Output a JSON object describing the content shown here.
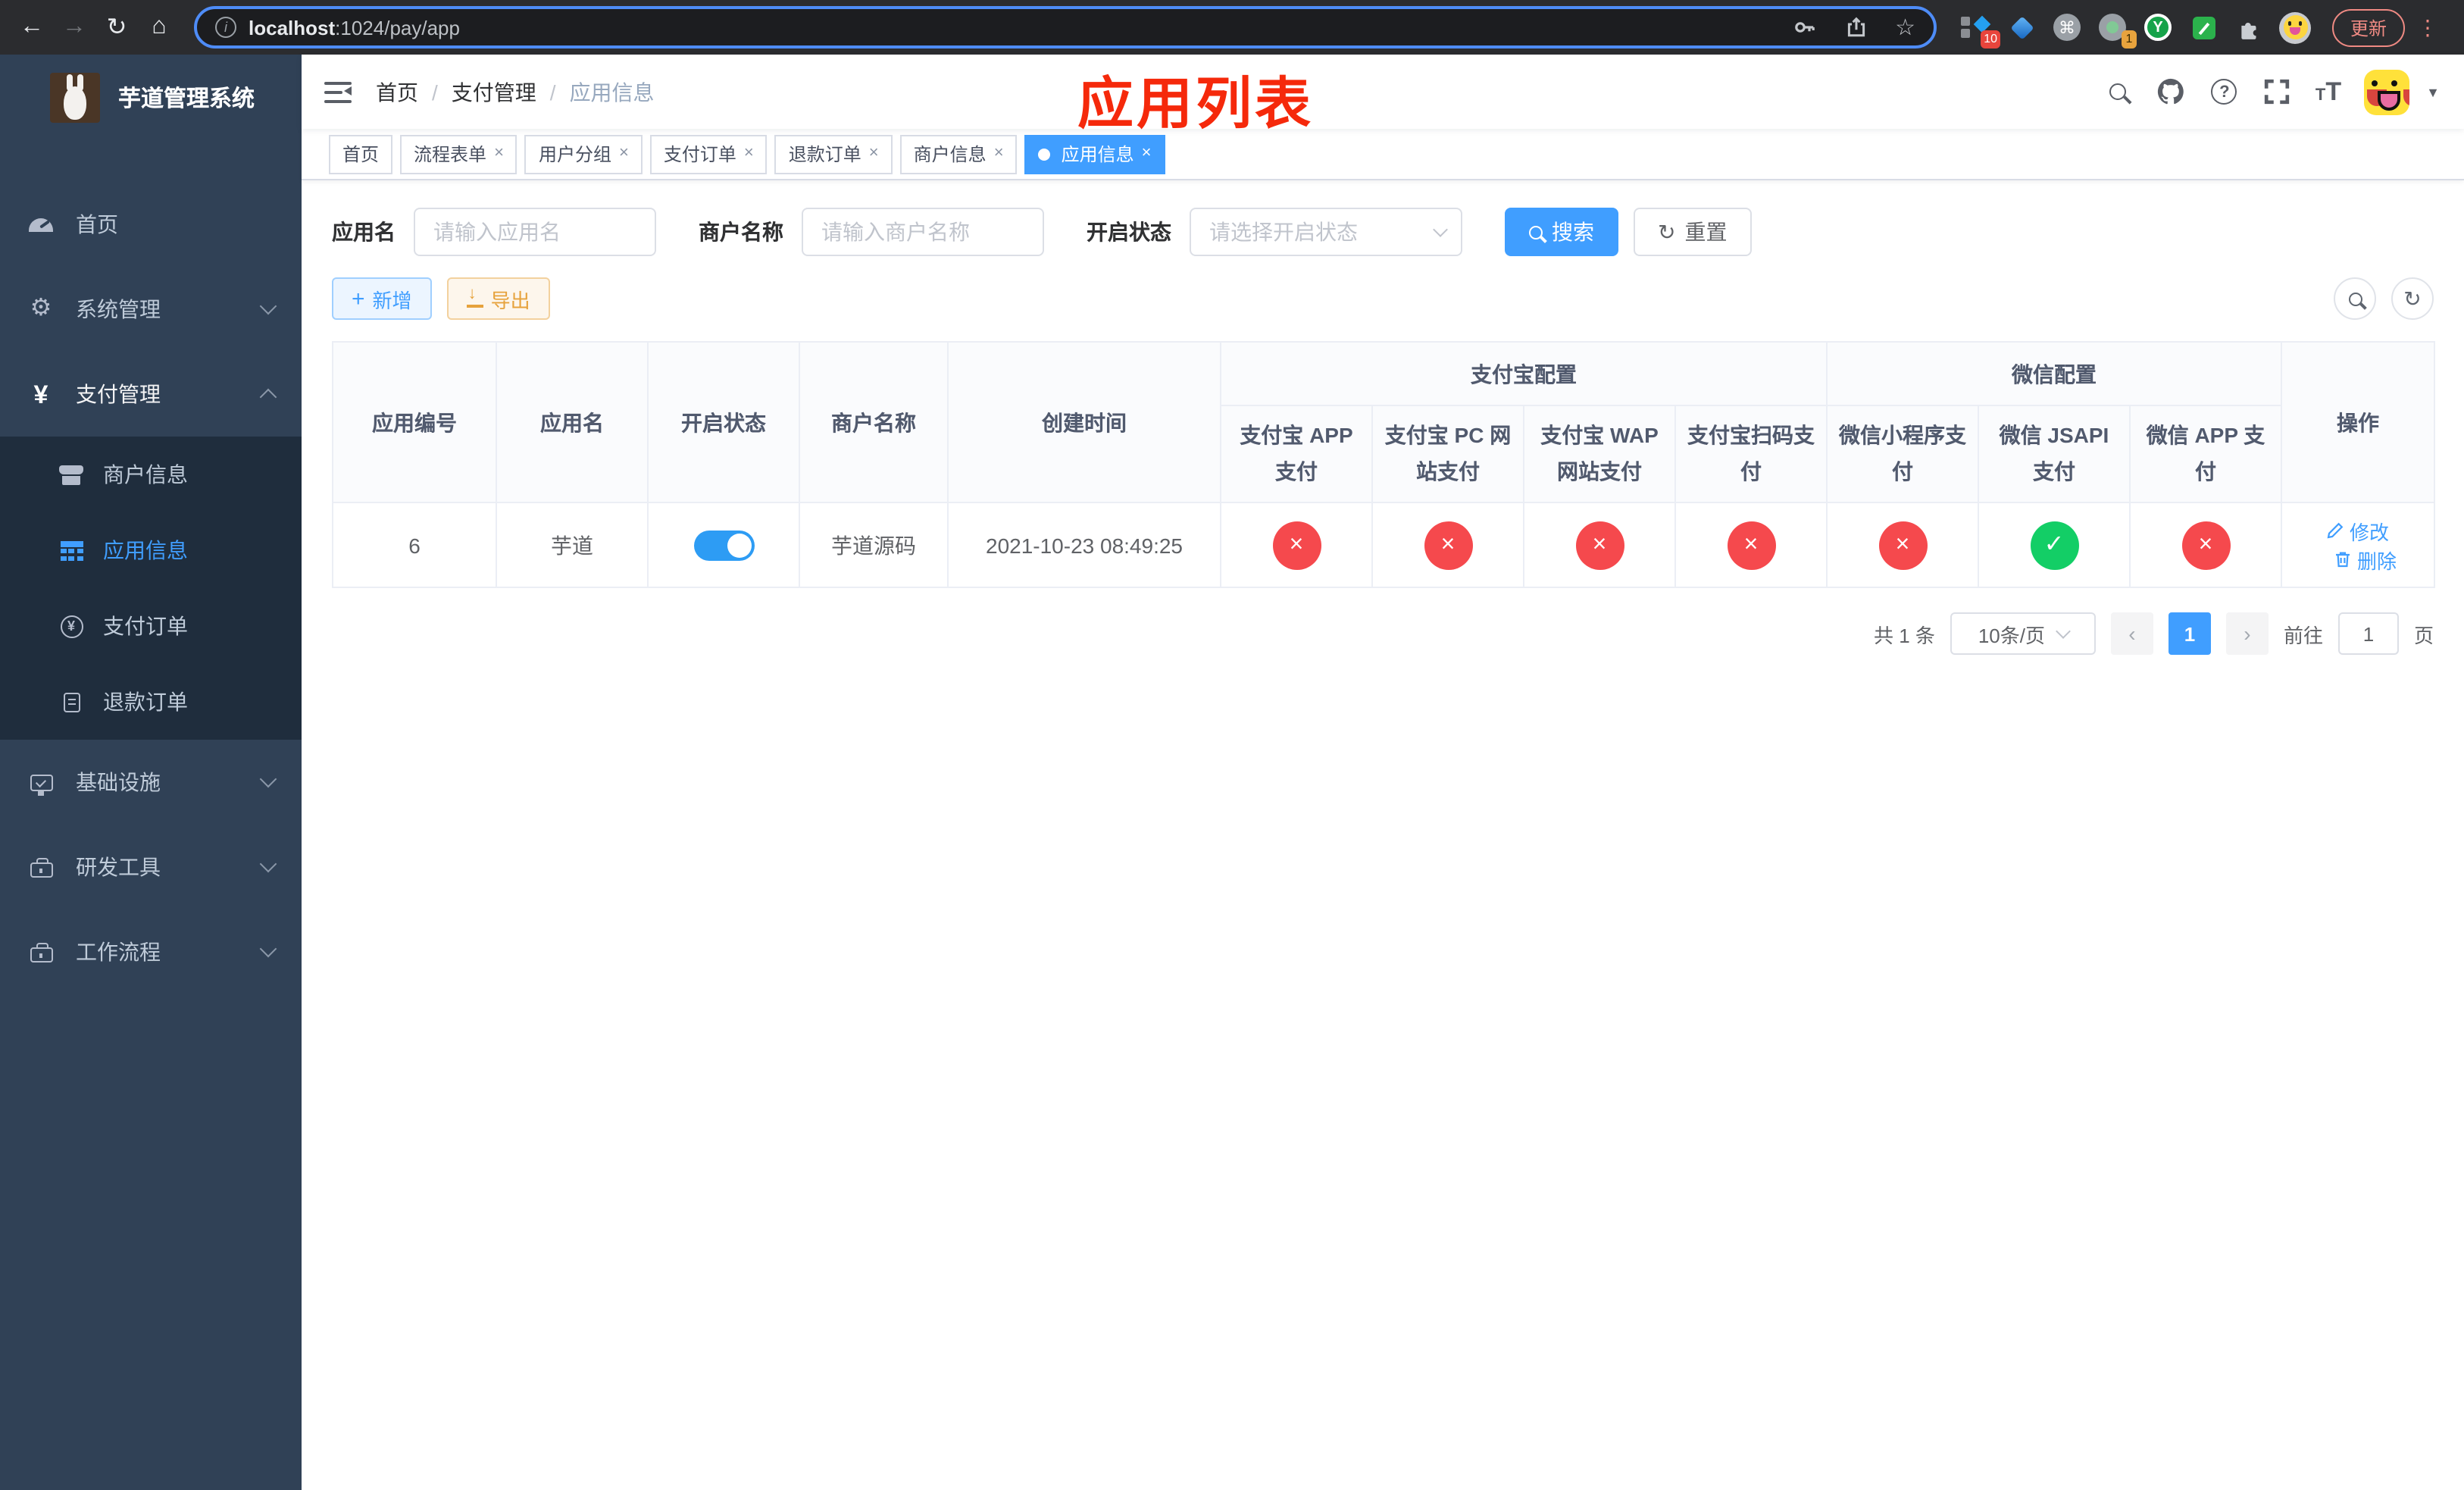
{
  "browser": {
    "url": {
      "host": "localhost",
      "path": ":1024/pay/app"
    },
    "update_label": "更新",
    "ext_badge_count": "10",
    "ext_badge_one": "1",
    "y_logo": "Y"
  },
  "icons": {
    "back": "←",
    "forward": "→",
    "reload": "↻",
    "home": "⌂",
    "info": "i",
    "star": "☆",
    "command": "⌘",
    "dots": "⋮",
    "caret_down": "▼",
    "plus": "+",
    "yen": "¥",
    "question": "?",
    "small_t": "T",
    "big_t": "T",
    "refresh": "↻",
    "prev": "‹",
    "next": "›"
  },
  "sidebar": {
    "brand": "芋道管理系统",
    "menu_top": [
      {
        "label": "首页"
      },
      {
        "label": "系统管理"
      },
      {
        "label": "支付管理"
      }
    ],
    "submenu": [
      {
        "label": "商户信息"
      },
      {
        "label": "应用信息"
      },
      {
        "label": "支付订单"
      },
      {
        "label": "退款订单"
      }
    ],
    "menu_bottom": [
      {
        "label": "基础设施"
      },
      {
        "label": "研发工具"
      },
      {
        "label": "工作流程"
      }
    ]
  },
  "navbar": {
    "breadcrumb": [
      {
        "label": "首页"
      },
      {
        "label": "支付管理"
      },
      {
        "label": "应用信息"
      }
    ],
    "separator": "/"
  },
  "annotation": "应用列表",
  "tags": [
    {
      "label": "首页",
      "closable": false,
      "active": false
    },
    {
      "label": "流程表单",
      "closable": true,
      "active": false
    },
    {
      "label": "用户分组",
      "closable": true,
      "active": false
    },
    {
      "label": "支付订单",
      "closable": true,
      "active": false
    },
    {
      "label": "退款订单",
      "closable": true,
      "active": false
    },
    {
      "label": "商户信息",
      "closable": true,
      "active": false
    },
    {
      "label": "应用信息",
      "closable": true,
      "active": true
    }
  ],
  "close_glyph": "×",
  "filter": {
    "app_name_label": "应用名",
    "app_name_placeholder": "请输入应用名",
    "merchant_label": "商户名称",
    "merchant_placeholder": "请输入商户名称",
    "status_label": "开启状态",
    "status_placeholder": "请选择开启状态",
    "search_label": "搜索",
    "reset_label": "重置"
  },
  "toolbar": {
    "add_label": "新增",
    "export_label": "导出"
  },
  "table": {
    "columns": {
      "app_id": "应用编号",
      "app_name": "应用名",
      "status": "开启状态",
      "merchant": "商户名称",
      "create_time": "创建时间",
      "alipay_group": "支付宝配置",
      "wechat_group": "微信配置",
      "actions": "操作",
      "alipay": [
        {
          "label": "支付宝 APP 支付"
        },
        {
          "label": "支付宝 PC 网站支付"
        },
        {
          "label": "支付宝 WAP 网站支付"
        },
        {
          "label": "支付宝扫码支付"
        }
      ],
      "wechat": [
        {
          "label": "微信小程序支付"
        },
        {
          "label": "微信 JSAPI 支付"
        },
        {
          "label": "微信 APP 支付"
        }
      ]
    },
    "row": {
      "app_id": "6",
      "app_name": "芋道",
      "status_on": true,
      "merchant": "芋道源码",
      "create_time": "2021-10-23 08:49:25",
      "configs": [
        {
          "name": "alipay-app-pay",
          "enabled": false,
          "symbol": "×"
        },
        {
          "name": "alipay-pc-pay",
          "enabled": false,
          "symbol": "×"
        },
        {
          "name": "alipay-wap-pay",
          "enabled": false,
          "symbol": "×"
        },
        {
          "name": "alipay-qr-pay",
          "enabled": false,
          "symbol": "×"
        },
        {
          "name": "wechat-mini-pay",
          "enabled": false,
          "symbol": "×"
        },
        {
          "name": "wechat-jsapi-pay",
          "enabled": true,
          "symbol": "✓"
        },
        {
          "name": "wechat-app-pay",
          "enabled": false,
          "symbol": "×"
        }
      ],
      "edit_label": "修改",
      "delete_label": "删除"
    }
  },
  "pagination": {
    "total": "共 1 条",
    "page_size": "10条/页",
    "page": "1",
    "goto_label": "前往",
    "goto_value": "1",
    "goto_suffix": "页"
  },
  "colors": {
    "primary": "#409EFF",
    "danger": "#f5494d",
    "success": "#13ce66",
    "annotation_red": "#f5290b",
    "sidebar_bg": "#304156",
    "submenu_bg": "#1f2d3d"
  }
}
